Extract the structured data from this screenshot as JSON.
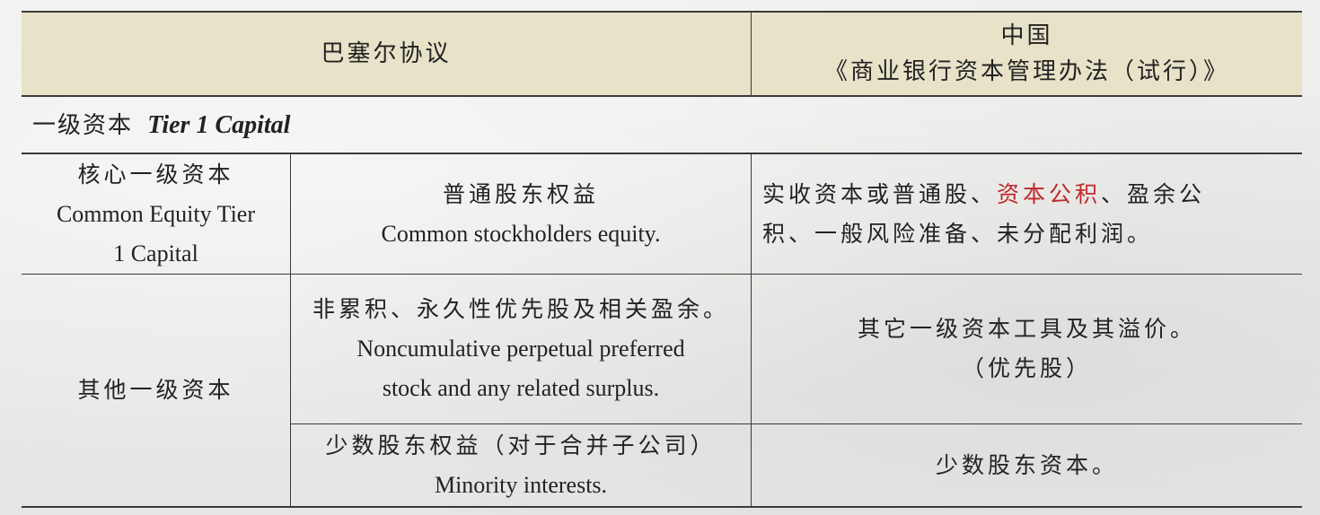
{
  "header": {
    "col1": "巴塞尔协议",
    "col2_line1": "中国",
    "col2_line2": "《商业银行资本管理办法（试行）》"
  },
  "section": {
    "title_cn": "一级资本",
    "title_en": "Tier 1 Capital"
  },
  "rows": [
    {
      "category_cn": "核心一级资本",
      "category_en_line1": "Common Equity Tier",
      "category_en_line2": "1 Capital",
      "basel_cn": "普通股东权益",
      "basel_en": "Common stockholders equity.",
      "china_part1": "实收资本或普通股、",
      "china_highlight": "资本公积",
      "china_part2": "、盈余公",
      "china_line2": "积、一般风险准备、未分配利润。"
    },
    {
      "category_cn": "其他一级资本",
      "basel_cn": "非累积、永久性优先股及相关盈余。",
      "basel_en_line1": "Noncumulative perpetual preferred",
      "basel_en_line2": "stock and any related surplus.",
      "china_line1": "其它一级资本工具及其溢价。",
      "china_line2": "（优先股）"
    },
    {
      "basel_cn": "少数股东权益（对于合并子公司）",
      "basel_en": "Minority interests.",
      "china": "少数股东资本。"
    }
  ],
  "colors": {
    "header_bg": "#e7e2c8",
    "highlight": "#c0282a",
    "rule": "#3a3a3a"
  }
}
